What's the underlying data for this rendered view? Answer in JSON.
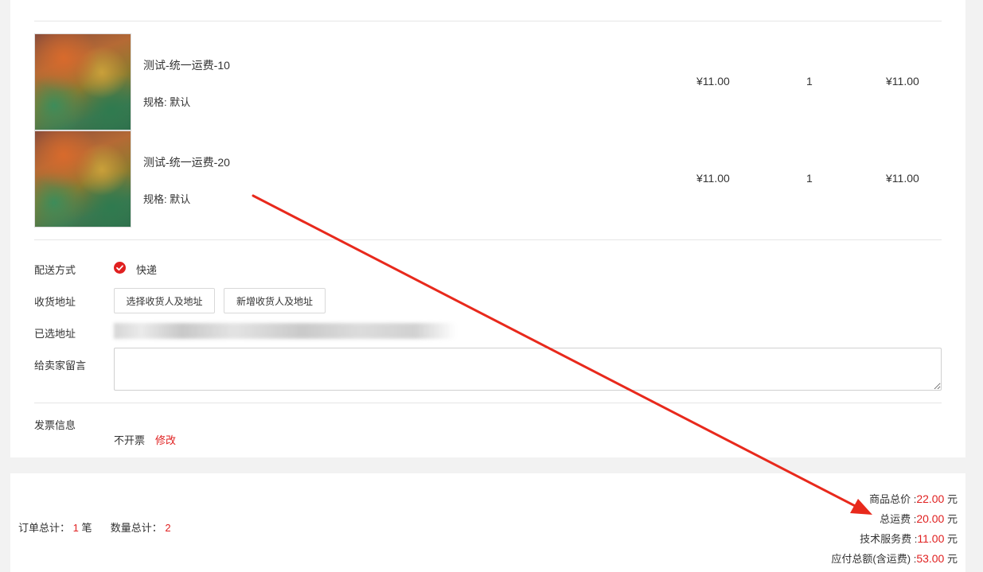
{
  "products": [
    {
      "name": "测试-统一运费-10",
      "spec": "规格: 默认",
      "price": "¥11.00",
      "qty": "1",
      "subtotal": "¥11.00"
    },
    {
      "name": "测试-统一运费-20",
      "spec": "规格: 默认",
      "price": "¥11.00",
      "qty": "1",
      "subtotal": "¥11.00"
    }
  ],
  "delivery": {
    "label": "配送方式",
    "value": "快递"
  },
  "address": {
    "label": "收货地址",
    "select_button": "选择收货人及地址",
    "add_button": "新增收货人及地址"
  },
  "selected_address": {
    "label": "已选地址"
  },
  "message": {
    "label": "给卖家留言",
    "value": ""
  },
  "invoice": {
    "label": "发票信息",
    "value": "不开票",
    "edit_link": "修改"
  },
  "summary": {
    "order_total_label": "订单总计：",
    "order_total_value": "1",
    "order_total_unit": "笔",
    "qty_total_label": "数量总计：",
    "qty_total_value": "2",
    "goods_total_label": "商品总价 :",
    "goods_total_value": "22.00",
    "shipping_label": "总运费 :",
    "shipping_value": "20.00",
    "service_fee_label": "技术服务费 :",
    "service_fee_value": "11.00",
    "payable_label": "应付总额(含运费) :",
    "payable_value": "53.00",
    "currency_unit": "元"
  },
  "colors": {
    "accent": "#e02020",
    "annotation_arrow": "#e8291c"
  }
}
